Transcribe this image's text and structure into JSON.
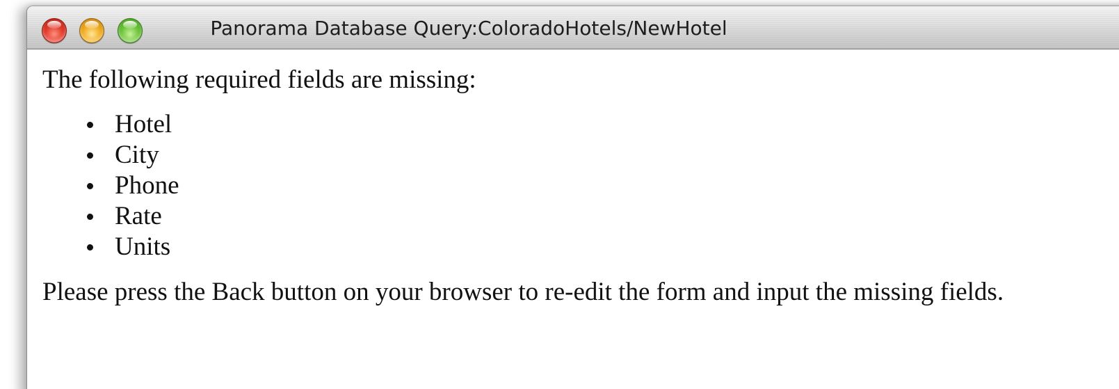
{
  "window": {
    "title": "Panorama Database Query:ColoradoHotels/NewHotel",
    "controls": {
      "close": "close-button",
      "minimize": "minimize-button",
      "zoom": "zoom-button"
    }
  },
  "page": {
    "intro": "The following required fields are missing:",
    "missing_fields": [
      "Hotel",
      "City",
      "Phone",
      "Rate",
      "Units"
    ],
    "note": "Please press the Back button on your browser to re-edit the form and input the missing fields."
  },
  "colors": {
    "close": "#e23a2a",
    "minimize": "#f1ad22",
    "zoom": "#6cc43a",
    "text": "#111111",
    "background": "#ffffff"
  }
}
